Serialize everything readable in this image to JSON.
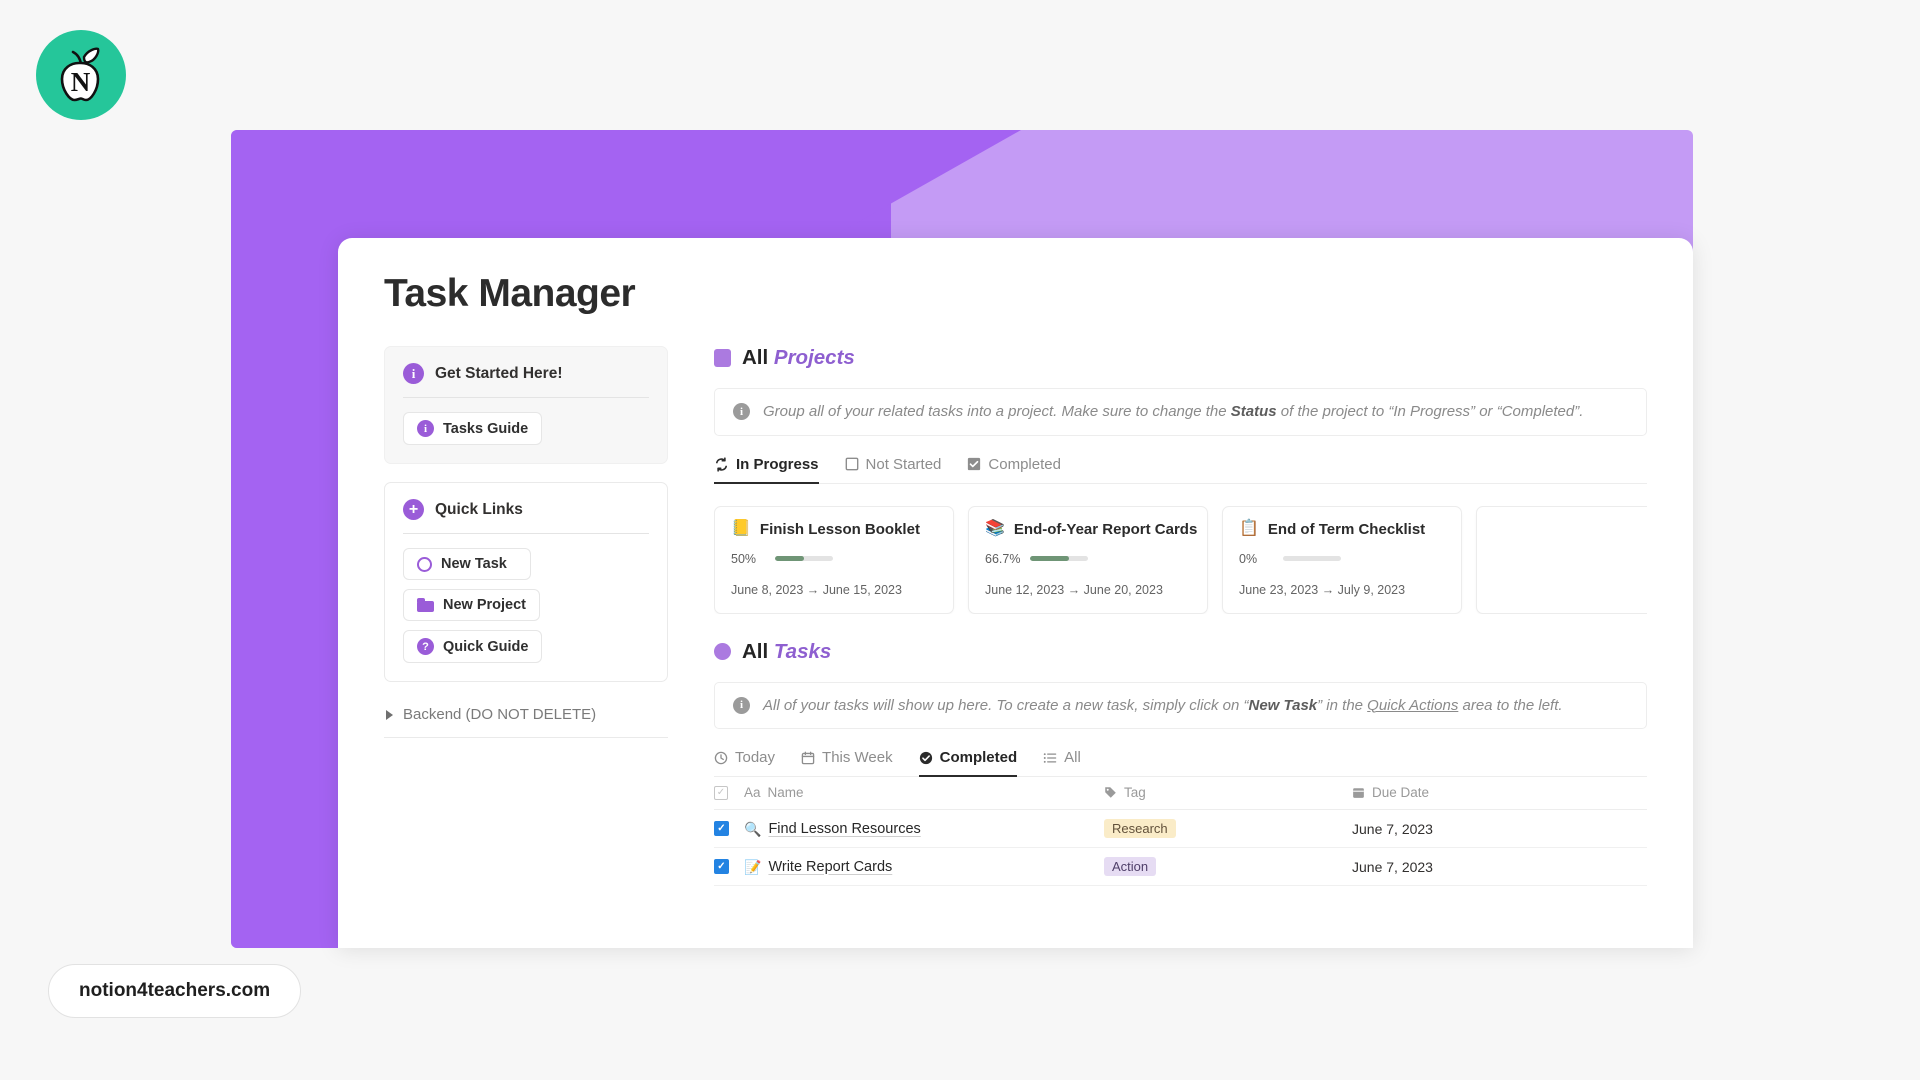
{
  "brand": {
    "logo_letter": "N",
    "logo_bg": "#25c69a",
    "footer_label": "notion4teachers.com"
  },
  "banner": {
    "color_light": "#c49bf5",
    "color_dark": "#a463f2"
  },
  "page": {
    "title": "Task Manager"
  },
  "sidebar": {
    "get_started": {
      "title": "Get Started Here!",
      "icon": "info-icon",
      "links": [
        {
          "label": "Tasks Guide",
          "icon": "info-icon"
        }
      ]
    },
    "quick_links": {
      "title": "Quick Links",
      "icon": "plus-icon",
      "links": [
        {
          "label": "New Task",
          "icon": "circle-icon"
        },
        {
          "label": "New Project",
          "icon": "folder-icon"
        },
        {
          "label": "Quick Guide",
          "icon": "question-icon"
        }
      ]
    },
    "backend": {
      "label": "Backend (DO NOT DELETE)",
      "icon": "triangle-right-icon"
    }
  },
  "projects": {
    "heading_prefix": "All",
    "heading_accent": "Projects",
    "accent_color": "#8e5fd0",
    "callout": {
      "text_1": "Group all of your related tasks into a project. Make sure to change the ",
      "bold_1": "Status",
      "text_2": " of the project to “In Progress” or “Completed”."
    },
    "tabs": [
      {
        "label": "In Progress",
        "icon": "sync-icon",
        "active": true
      },
      {
        "label": "Not Started",
        "icon": "empty-checkbox-icon",
        "active": false
      },
      {
        "label": "Completed",
        "icon": "checked-checkbox-icon",
        "active": false
      }
    ],
    "cards": [
      {
        "emoji": "📒",
        "name": "Finish Lesson Booklet",
        "percent_label": "50%",
        "percent": 50,
        "dates": "June 8, 2023 → June 15, 2023"
      },
      {
        "emoji": "📚",
        "name": "End-of-Year Report Cards",
        "percent_label": "66.7%",
        "percent": 66.7,
        "dates": "June 12, 2023 → June 20, 2023"
      },
      {
        "emoji": "📋",
        "name": "End of Term Checklist",
        "percent_label": "0%",
        "percent": 0,
        "dates": "June 23, 2023 → July 9, 2023"
      }
    ]
  },
  "tasks": {
    "heading_prefix": "All",
    "heading_accent": "Tasks",
    "callout": {
      "text_1": "All of your tasks will show up here. To create a new task, simply click on “",
      "bold_1": "New Task",
      "text_2": "” in the ",
      "underline_1": "Quick Actions",
      "text_3": " area to the left."
    },
    "tabs": [
      {
        "label": "Today",
        "icon": "clock-icon",
        "active": false
      },
      {
        "label": "This Week",
        "icon": "calendar-icon",
        "active": false
      },
      {
        "label": "Completed",
        "icon": "check-circle-icon",
        "active": true
      },
      {
        "label": "All",
        "icon": "list-icon",
        "active": false
      }
    ],
    "columns": {
      "name": "Name",
      "name_type": "Aa",
      "tag": "Tag",
      "due_date": "Due Date"
    },
    "rows": [
      {
        "checked": true,
        "emoji": "🔍",
        "name": "Find Lesson Resources",
        "tag": "Research",
        "tag_style": "research",
        "due_date": "June 7, 2023"
      },
      {
        "checked": true,
        "emoji": "📝",
        "name": "Write Report Cards",
        "tag": "Action",
        "tag_style": "action",
        "due_date": "June 7, 2023"
      }
    ]
  }
}
